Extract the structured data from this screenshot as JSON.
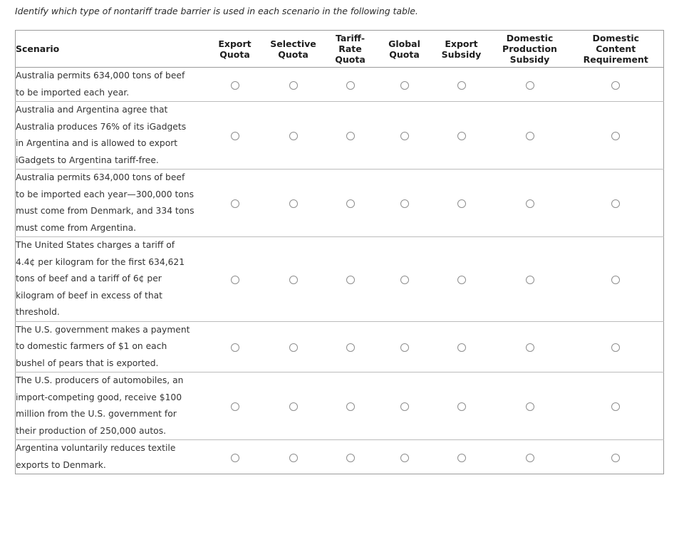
{
  "instruction": "Identify which type of nontariff trade barrier is used in each scenario in the following table.",
  "table": {
    "scenario_header": "Scenario",
    "columns": [
      {
        "id": "export-quota",
        "lines": [
          "Export",
          "Quota"
        ]
      },
      {
        "id": "selective-quota",
        "lines": [
          "Selective",
          "Quota"
        ]
      },
      {
        "id": "tariff-rate-quota",
        "lines": [
          "Tariff-",
          "Rate",
          "Quota"
        ]
      },
      {
        "id": "global-quota",
        "lines": [
          "Global",
          "Quota"
        ]
      },
      {
        "id": "export-subsidy",
        "lines": [
          "Export",
          "Subsidy"
        ]
      },
      {
        "id": "domestic-production-subsidy",
        "lines": [
          "Domestic",
          "Production",
          "Subsidy"
        ]
      },
      {
        "id": "domestic-content-requirement",
        "lines": [
          "Domestic",
          "Content",
          "Requirement"
        ]
      }
    ],
    "rows": [
      {
        "id": "row-1",
        "lines": [
          "Australia permits 634,000 tons of beef",
          "to be imported each year."
        ],
        "selected": null
      },
      {
        "id": "row-2",
        "lines": [
          "Australia and Argentina agree that",
          "Australia produces 76% of its iGadgets",
          "in Argentina and is allowed to export",
          "iGadgets to Argentina tariff-free."
        ],
        "selected": null
      },
      {
        "id": "row-3",
        "lines": [
          "Australia permits 634,000 tons of beef",
          "to be imported each year—300,000 tons",
          "must come from Denmark, and 334 tons",
          "must come from Argentina."
        ],
        "selected": null
      },
      {
        "id": "row-4",
        "lines": [
          "The United States charges a tariff of",
          "4.4¢ per kilogram for the first 634,621",
          "tons of beef and a tariff of 6¢ per",
          "kilogram of beef in excess of that",
          "threshold."
        ],
        "selected": null
      },
      {
        "id": "row-5",
        "lines": [
          "The U.S. government makes a payment",
          "to domestic farmers of $1 on each",
          "bushel of pears that is exported."
        ],
        "selected": null
      },
      {
        "id": "row-6",
        "lines": [
          "The U.S. producers of automobiles, an",
          "import-competing good, receive $100",
          "million from the U.S. government for",
          "their production of 250,000 autos."
        ],
        "selected": null
      },
      {
        "id": "row-7",
        "lines": [
          "Argentina voluntarily reduces textile",
          "exports to Denmark."
        ],
        "selected": null
      }
    ]
  },
  "colors": {
    "text": "#333333",
    "header_text": "#1d1d1d",
    "table_border": "#9a9a9a",
    "row_divider": "#bcbcbc",
    "radio_border": "#8e8e8e",
    "background": "#ffffff"
  }
}
